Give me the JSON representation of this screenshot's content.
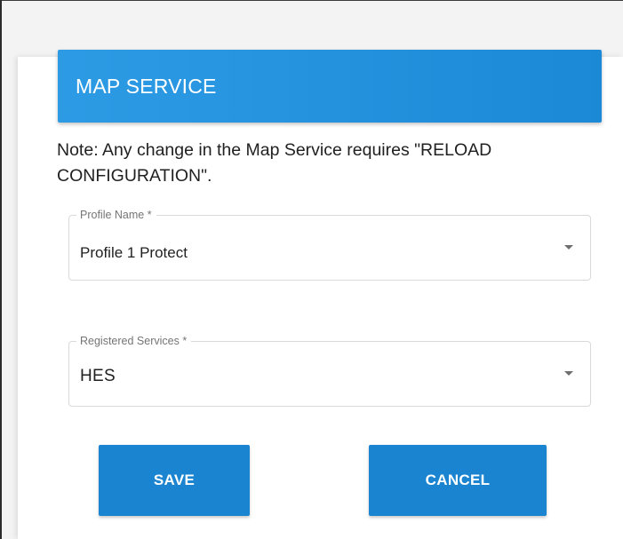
{
  "dialog": {
    "title": "MAP SERVICE",
    "note": "Note: Any change in the Map Service requires \"RELOAD CONFIGURATION\"."
  },
  "fields": {
    "profile_name": {
      "label": "Profile Name *",
      "value": "Profile 1 Protect",
      "icon": "chevron-down-icon"
    },
    "registered_services": {
      "label": "Registered Services *",
      "value": "HES",
      "icon": "chevron-down-icon"
    }
  },
  "actions": {
    "save_label": "SAVE",
    "cancel_label": "CANCEL"
  },
  "colors": {
    "header_blue": "#2d9be4",
    "button_blue": "#1b84d1",
    "text_dark": "#212121",
    "label_gray": "#757575",
    "border_gray": "#d9d9d9"
  }
}
